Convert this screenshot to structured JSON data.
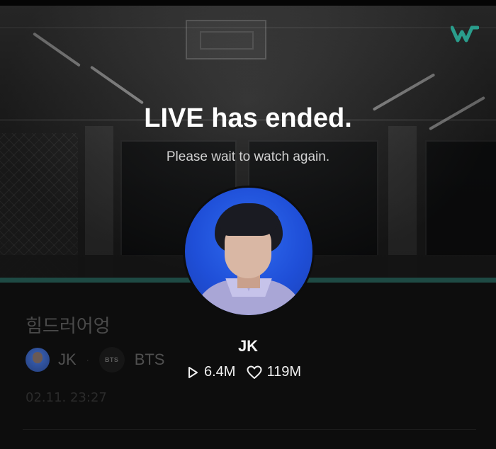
{
  "overlay": {
    "title": "LIVE has ended.",
    "subtitle": "Please wait to watch again."
  },
  "logo": {
    "icon": "weverse-logo-icon",
    "color": "#2a9d8c"
  },
  "artist": {
    "name": "JK",
    "avatar": "artist-avatar",
    "plays": "6.4M",
    "likes": "119M"
  },
  "video_info": {
    "title": "힘드러어엉",
    "author": "JK",
    "separator": "·",
    "channel_badge": "BTS",
    "channel": "BTS",
    "date": "02.11. 23:27"
  },
  "colors": {
    "background": "#0d0d0d",
    "accent_line": "#1e4a44",
    "avatar_bg": "#2f6bf0"
  }
}
